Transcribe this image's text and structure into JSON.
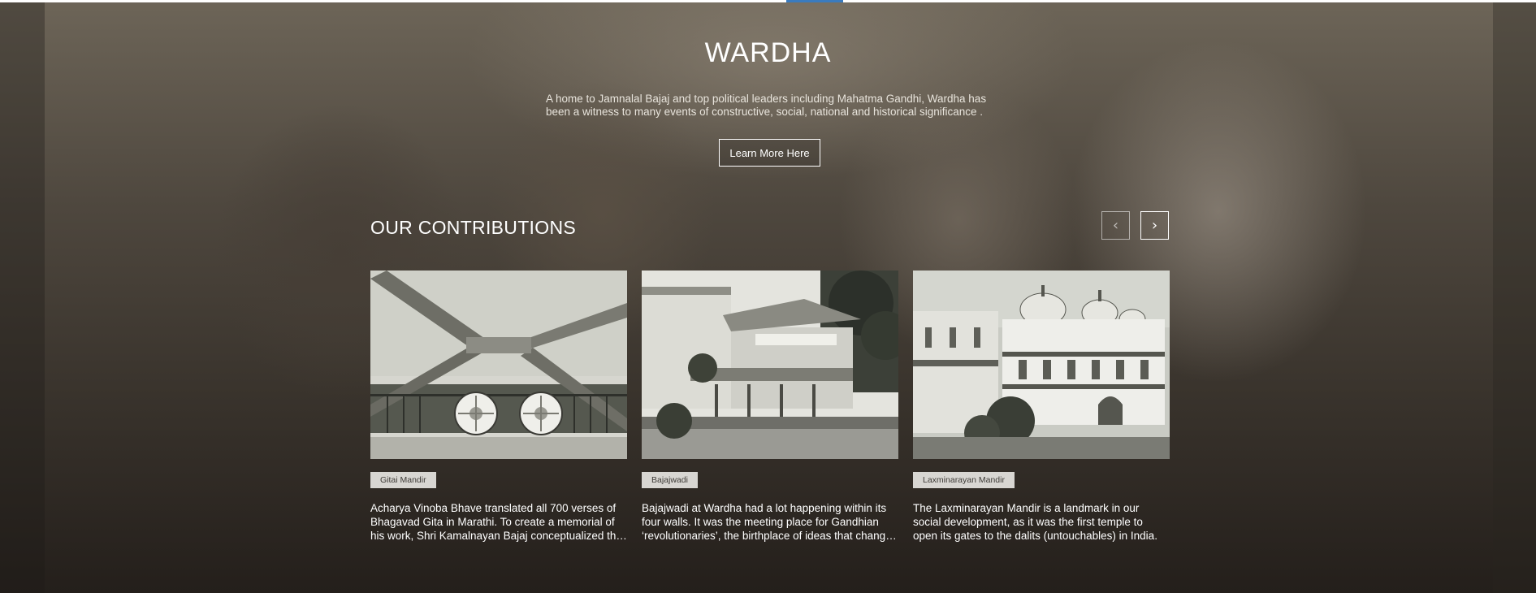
{
  "hero": {
    "title": "WARDHA",
    "description": "A home to Jamnalal Bajaj and top political leaders including Mahatma Gandhi, Wardha has been a witness to many events of constructive, social, national and historical significance .",
    "cta_label": "Learn More Here"
  },
  "contributions": {
    "heading": "OUR CONTRIBUTIONS",
    "prev_icon": "‹",
    "next_icon": "›",
    "cards": [
      {
        "tag": "Gitai Mandir",
        "text": "Acharya Vinoba Bhave translated all 700 verses of Bhagavad Gita in Marathi. To create a memorial of his work, Shri Kamalnayan Bajaj conceptualized the Gitai Mandir, where the verses are inscribed on stone slabs."
      },
      {
        "tag": "Bajajwadi",
        "text": "Bajajwadi at Wardha had a lot happening within its four walls. It was the meeting place for Gandhian ‘revolutionaries’, the birthplace of ideas that changed the course of the freedom struggle."
      },
      {
        "tag": "Laxminarayan Mandir",
        "text": "The Laxminarayan Mandir is a landmark in our social development, as it was the first temple to open its gates to the dalits (untouchables) in India."
      }
    ]
  },
  "colors": {
    "accent": "#3a7bbf",
    "tag_bg": "#d8d6d2",
    "text": "#ffffff"
  }
}
